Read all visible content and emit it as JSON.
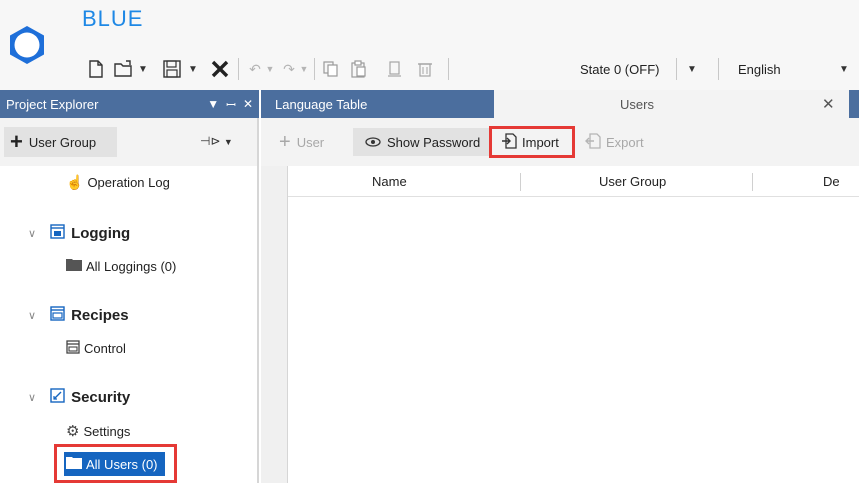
{
  "app": {
    "title": "BLUE"
  },
  "toolbar": {
    "state_combo": "State 0 (OFF)",
    "language_combo": "English",
    "icons": [
      "new-file-icon",
      "open-folder-icon",
      "save-icon",
      "delete-icon",
      "undo-icon",
      "redo-icon",
      "copy-icon",
      "paste-icon",
      "duplicate-icon",
      "trash-icon"
    ]
  },
  "project_explorer": {
    "title": "Project Explorer",
    "add_button": "User Group",
    "tree": {
      "operation_log": "Operation Log",
      "logging": "Logging",
      "all_loggings": "All Loggings (0)",
      "recipes": "Recipes",
      "control": "Control",
      "security": "Security",
      "settings": "Settings",
      "all_users": "All Users (0)"
    }
  },
  "tabs": {
    "language_table": "Language Table",
    "users": "Users"
  },
  "users_toolbar": {
    "add_user": "User",
    "show_password": "Show Password",
    "import": "Import",
    "export": "Export"
  },
  "grid": {
    "columns": [
      "Name",
      "User Group",
      "De"
    ]
  },
  "colors": {
    "accent": "#4b6e9e",
    "highlight": "#e53935",
    "selected": "#1565c0",
    "brand": "#1e88e5"
  }
}
